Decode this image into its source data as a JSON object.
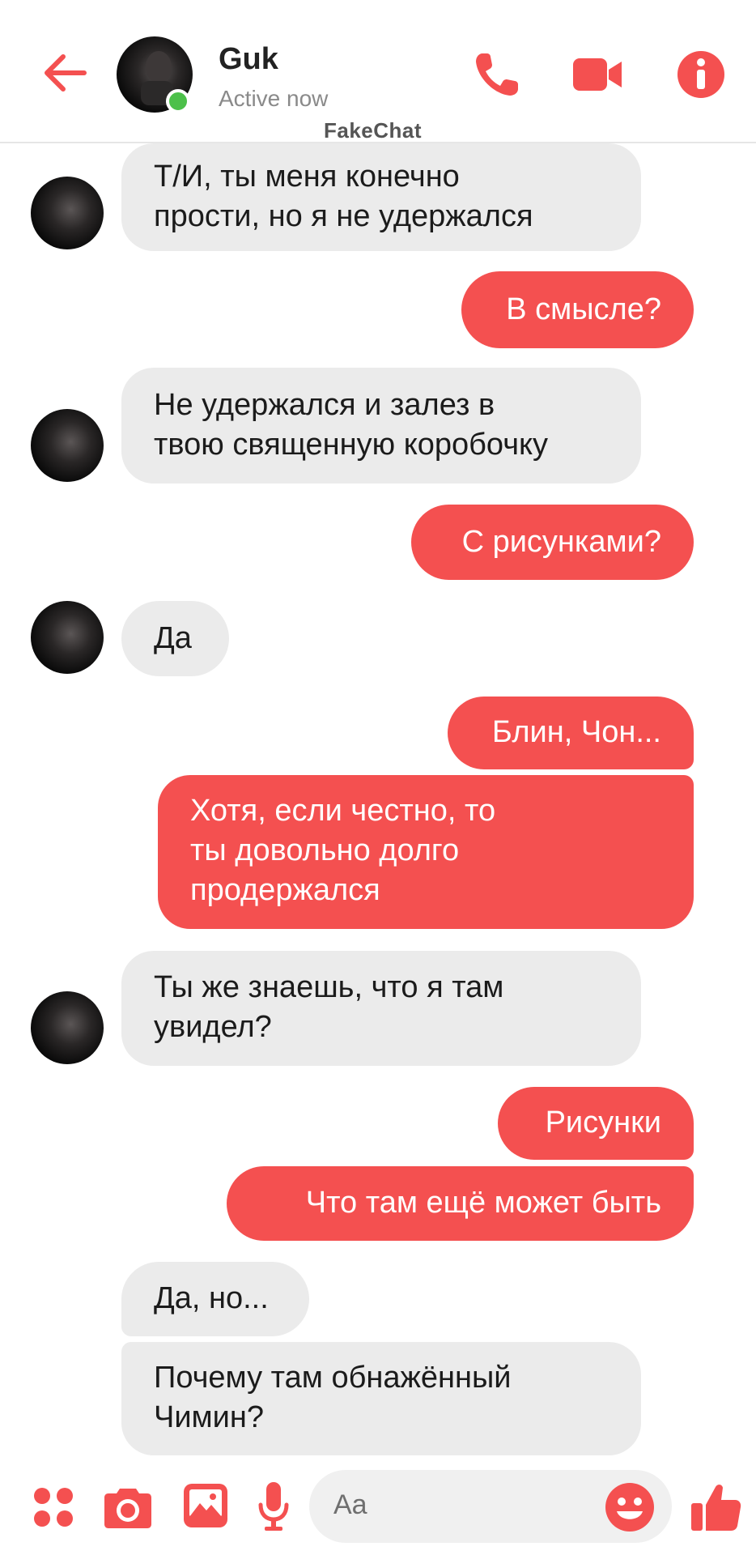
{
  "header": {
    "contact_name": "Guk",
    "status": "Active now",
    "brand": "FakeChat",
    "accent": "#f45050"
  },
  "messages": [
    {
      "side": "in",
      "text": "Т/И, ты меня конечно\nпрости, но я не удержался",
      "avatar": true
    },
    {
      "side": "out",
      "text": "В смысле?"
    },
    {
      "side": "in",
      "text": "Не удержался и залез в\nтвою священную коробочку",
      "avatar": true
    },
    {
      "side": "out",
      "text": "С рисунками?"
    },
    {
      "side": "in",
      "text": "Да",
      "avatar": true
    },
    {
      "side": "out",
      "text": "Блин, Чон..."
    },
    {
      "side": "out",
      "text": "Хотя, если честно, то\nты довольно долго\nпродержался"
    },
    {
      "side": "in",
      "text": "Ты же знаешь, что я там\nувидел?",
      "avatar": true
    },
    {
      "side": "out",
      "text": "Рисунки"
    },
    {
      "side": "out",
      "text": "Что там ещё может быть"
    },
    {
      "side": "in",
      "text": "Да, но...",
      "avatar": false
    },
    {
      "side": "in",
      "text": "Почему там обнажённый\nЧимин?",
      "avatar": false
    }
  ],
  "composer": {
    "placeholder": "Aa",
    "icons": [
      "apps-icon",
      "camera-icon",
      "gallery-icon",
      "microphone-icon",
      "emoji-icon",
      "thumbs-up-icon"
    ]
  }
}
